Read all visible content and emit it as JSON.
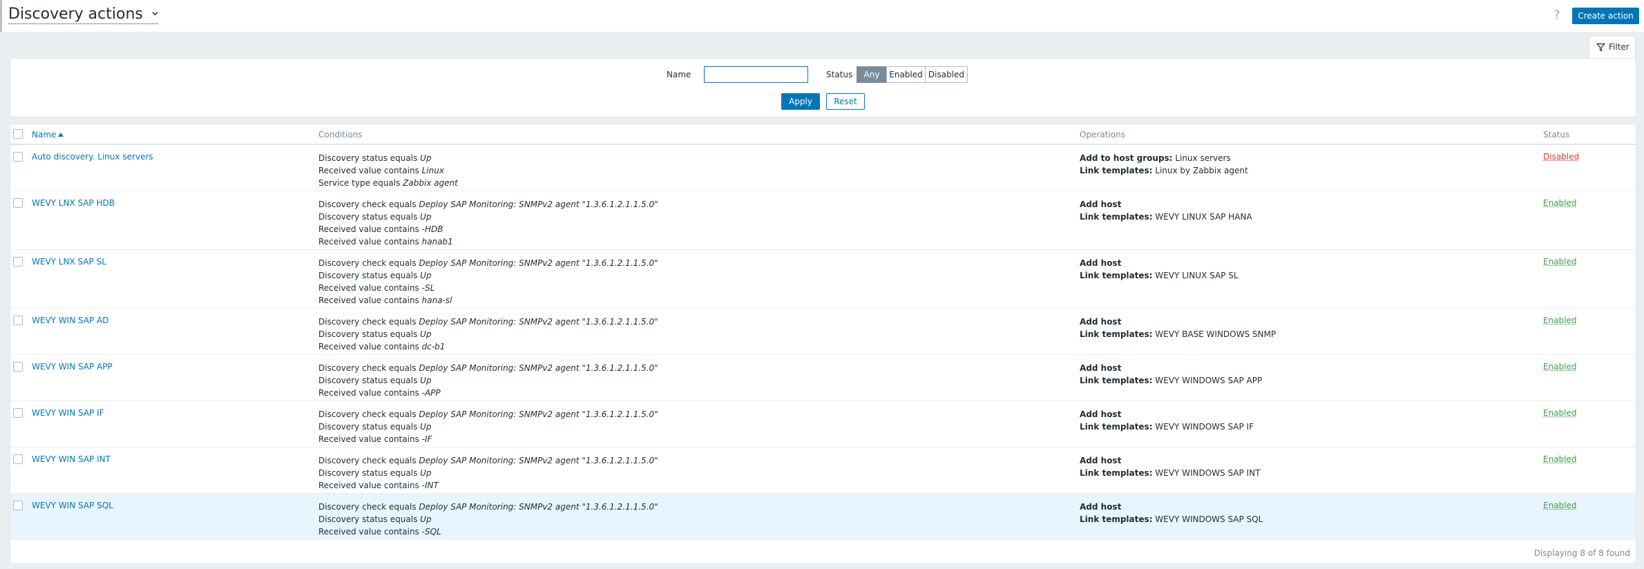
{
  "header": {
    "title": "Discovery actions",
    "help_label": "?",
    "create_label": "Create action"
  },
  "filter": {
    "tab_label": "Filter",
    "name_label": "Name",
    "name_value": "",
    "status_label": "Status",
    "status_options": [
      "Any",
      "Enabled",
      "Disabled"
    ],
    "status_selected": "Any",
    "apply_label": "Apply",
    "reset_label": "Reset"
  },
  "table": {
    "columns": {
      "name": "Name",
      "conditions": "Conditions",
      "operations": "Operations",
      "status": "Status"
    },
    "sort": {
      "column": "Name",
      "direction": "ascending"
    },
    "rows": [
      {
        "name": "Auto discovery. Linux servers",
        "conditions": [
          [
            "Discovery status equals ",
            "Up"
          ],
          [
            "Received value contains ",
            "Linux"
          ],
          [
            "Service type equals ",
            "Zabbix agent"
          ]
        ],
        "operations": [
          [
            "Add to host groups:",
            " Linux servers"
          ],
          [
            "Link templates:",
            " Linux by Zabbix agent"
          ]
        ],
        "status": "Disabled"
      },
      {
        "name": "WEVY LNX SAP HDB",
        "conditions": [
          [
            "Discovery check equals ",
            "Deploy SAP Monitoring: SNMPv2 agent \"1.3.6.1.2.1.1.5.0\""
          ],
          [
            "Discovery status equals ",
            "Up"
          ],
          [
            "Received value contains ",
            "-HDB"
          ],
          [
            "Received value contains ",
            "hanab1"
          ]
        ],
        "operations": [
          [
            "Add host",
            ""
          ],
          [
            "Link templates:",
            " WEVY LINUX SAP HANA"
          ]
        ],
        "status": "Enabled"
      },
      {
        "name": "WEVY LNX SAP SL",
        "conditions": [
          [
            "Discovery check equals ",
            "Deploy SAP Monitoring: SNMPv2 agent \"1.3.6.1.2.1.1.5.0\""
          ],
          [
            "Discovery status equals ",
            "Up"
          ],
          [
            "Received value contains ",
            "-SL"
          ],
          [
            "Received value contains ",
            "hana-sl"
          ]
        ],
        "operations": [
          [
            "Add host",
            ""
          ],
          [
            "Link templates:",
            " WEVY LINUX SAP SL"
          ]
        ],
        "status": "Enabled"
      },
      {
        "name": "WEVY WIN SAP AD",
        "conditions": [
          [
            "Discovery check equals ",
            "Deploy SAP Monitoring: SNMPv2 agent \"1.3.6.1.2.1.1.5.0\""
          ],
          [
            "Discovery status equals ",
            "Up"
          ],
          [
            "Received value contains ",
            "dc-b1"
          ]
        ],
        "operations": [
          [
            "Add host",
            ""
          ],
          [
            "Link templates:",
            " WEVY BASE WINDOWS SNMP"
          ]
        ],
        "status": "Enabled"
      },
      {
        "name": "WEVY WIN SAP APP",
        "conditions": [
          [
            "Discovery check equals ",
            "Deploy SAP Monitoring: SNMPv2 agent \"1.3.6.1.2.1.1.5.0\""
          ],
          [
            "Discovery status equals ",
            "Up"
          ],
          [
            "Received value contains ",
            "-APP"
          ]
        ],
        "operations": [
          [
            "Add host",
            ""
          ],
          [
            "Link templates:",
            " WEVY WINDOWS SAP APP"
          ]
        ],
        "status": "Enabled"
      },
      {
        "name": "WEVY WIN SAP IF",
        "conditions": [
          [
            "Discovery check equals ",
            "Deploy SAP Monitoring: SNMPv2 agent \"1.3.6.1.2.1.1.5.0\""
          ],
          [
            "Discovery status equals ",
            "Up"
          ],
          [
            "Received value contains ",
            "-IF"
          ]
        ],
        "operations": [
          [
            "Add host",
            ""
          ],
          [
            "Link templates:",
            " WEVY WINDOWS SAP IF"
          ]
        ],
        "status": "Enabled"
      },
      {
        "name": "WEVY WIN SAP INT",
        "conditions": [
          [
            "Discovery check equals ",
            "Deploy SAP Monitoring: SNMPv2 agent \"1.3.6.1.2.1.1.5.0\""
          ],
          [
            "Discovery status equals ",
            "Up"
          ],
          [
            "Received value contains ",
            "-INT"
          ]
        ],
        "operations": [
          [
            "Add host",
            ""
          ],
          [
            "Link templates:",
            " WEVY WINDOWS SAP INT"
          ]
        ],
        "status": "Enabled"
      },
      {
        "name": "WEVY WIN SAP SQL",
        "conditions": [
          [
            "Discovery check equals ",
            "Deploy SAP Monitoring: SNMPv2 agent \"1.3.6.1.2.1.1.5.0\""
          ],
          [
            "Discovery status equals ",
            "Up"
          ],
          [
            "Received value contains ",
            "-SQL"
          ]
        ],
        "operations": [
          [
            "Add host",
            ""
          ],
          [
            "Link templates:",
            " WEVY WINDOWS SAP SQL"
          ]
        ],
        "status": "Enabled",
        "highlighted": true
      }
    ],
    "footer": "Displaying 8 of 8 found"
  },
  "colors": {
    "accent": "#0275b8",
    "enabled": "#429e47",
    "disabled": "#e33734",
    "selected_segment": "#768d99"
  }
}
